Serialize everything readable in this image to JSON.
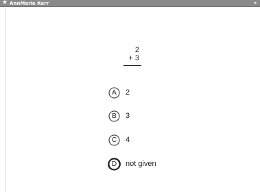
{
  "window": {
    "title": "AnnMarie Kerr",
    "title_icon": "star-icon",
    "right_icon": "scroll-arrow-icon"
  },
  "problem": {
    "top_number": "2",
    "bottom_line": "+ 3"
  },
  "choices": [
    {
      "letter": "A",
      "text": "2",
      "selected": false
    },
    {
      "letter": "B",
      "text": "3",
      "selected": false
    },
    {
      "letter": "C",
      "text": "4",
      "selected": false
    },
    {
      "letter": "D",
      "text": "not given",
      "selected": true
    }
  ],
  "colors": {
    "titlebar": "#8a8a8a",
    "text": "#222222",
    "background": "#ffffff"
  }
}
